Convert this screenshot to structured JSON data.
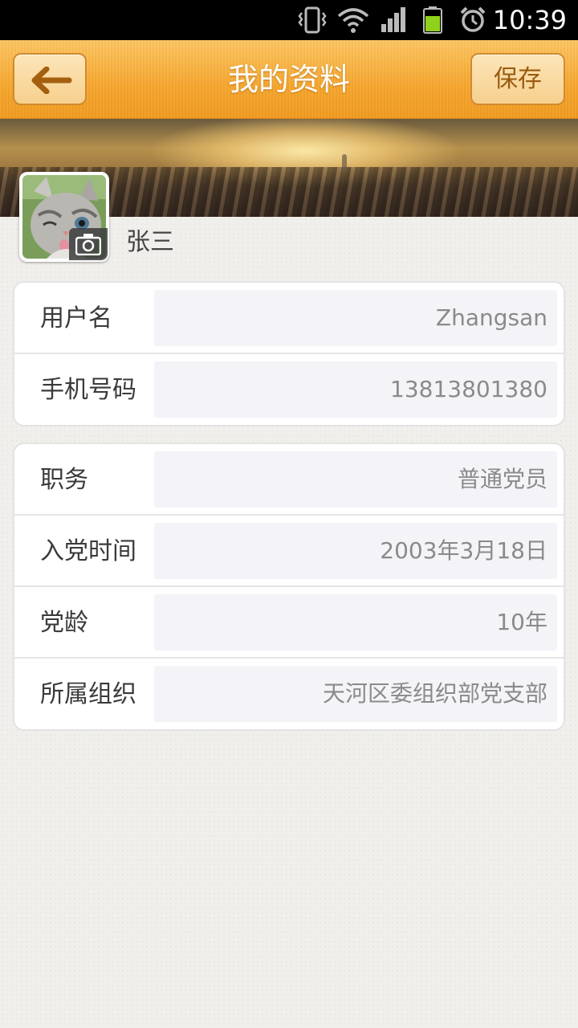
{
  "status_bar": {
    "time": "10:39",
    "icons": [
      "vibrate-icon",
      "wifi-icon",
      "signal-icon",
      "battery-icon",
      "alarm-icon"
    ]
  },
  "header": {
    "title": "我的资料",
    "back_icon": "back-arrow-icon",
    "save_label": "保存"
  },
  "profile": {
    "name": "张三",
    "avatar_badge_icon": "camera-icon"
  },
  "account": {
    "username_label": "用户名",
    "username_value": "Zhangsan",
    "phone_label": "手机号码",
    "phone_value": "13813801380"
  },
  "party": {
    "position_label": "职务",
    "position_value": "普通党员",
    "join_date_label": "入党时间",
    "join_date_value": "2003年3月18日",
    "party_age_label": "党龄",
    "party_age_value": "10年",
    "organization_label": "所属组织",
    "organization_value": "天河区委组织部党支部"
  },
  "colors": {
    "header_orange": "#f5a52c",
    "button_border": "#d08a2e",
    "field_bg": "#f3f3f8",
    "value_text": "#8a8a8a"
  }
}
